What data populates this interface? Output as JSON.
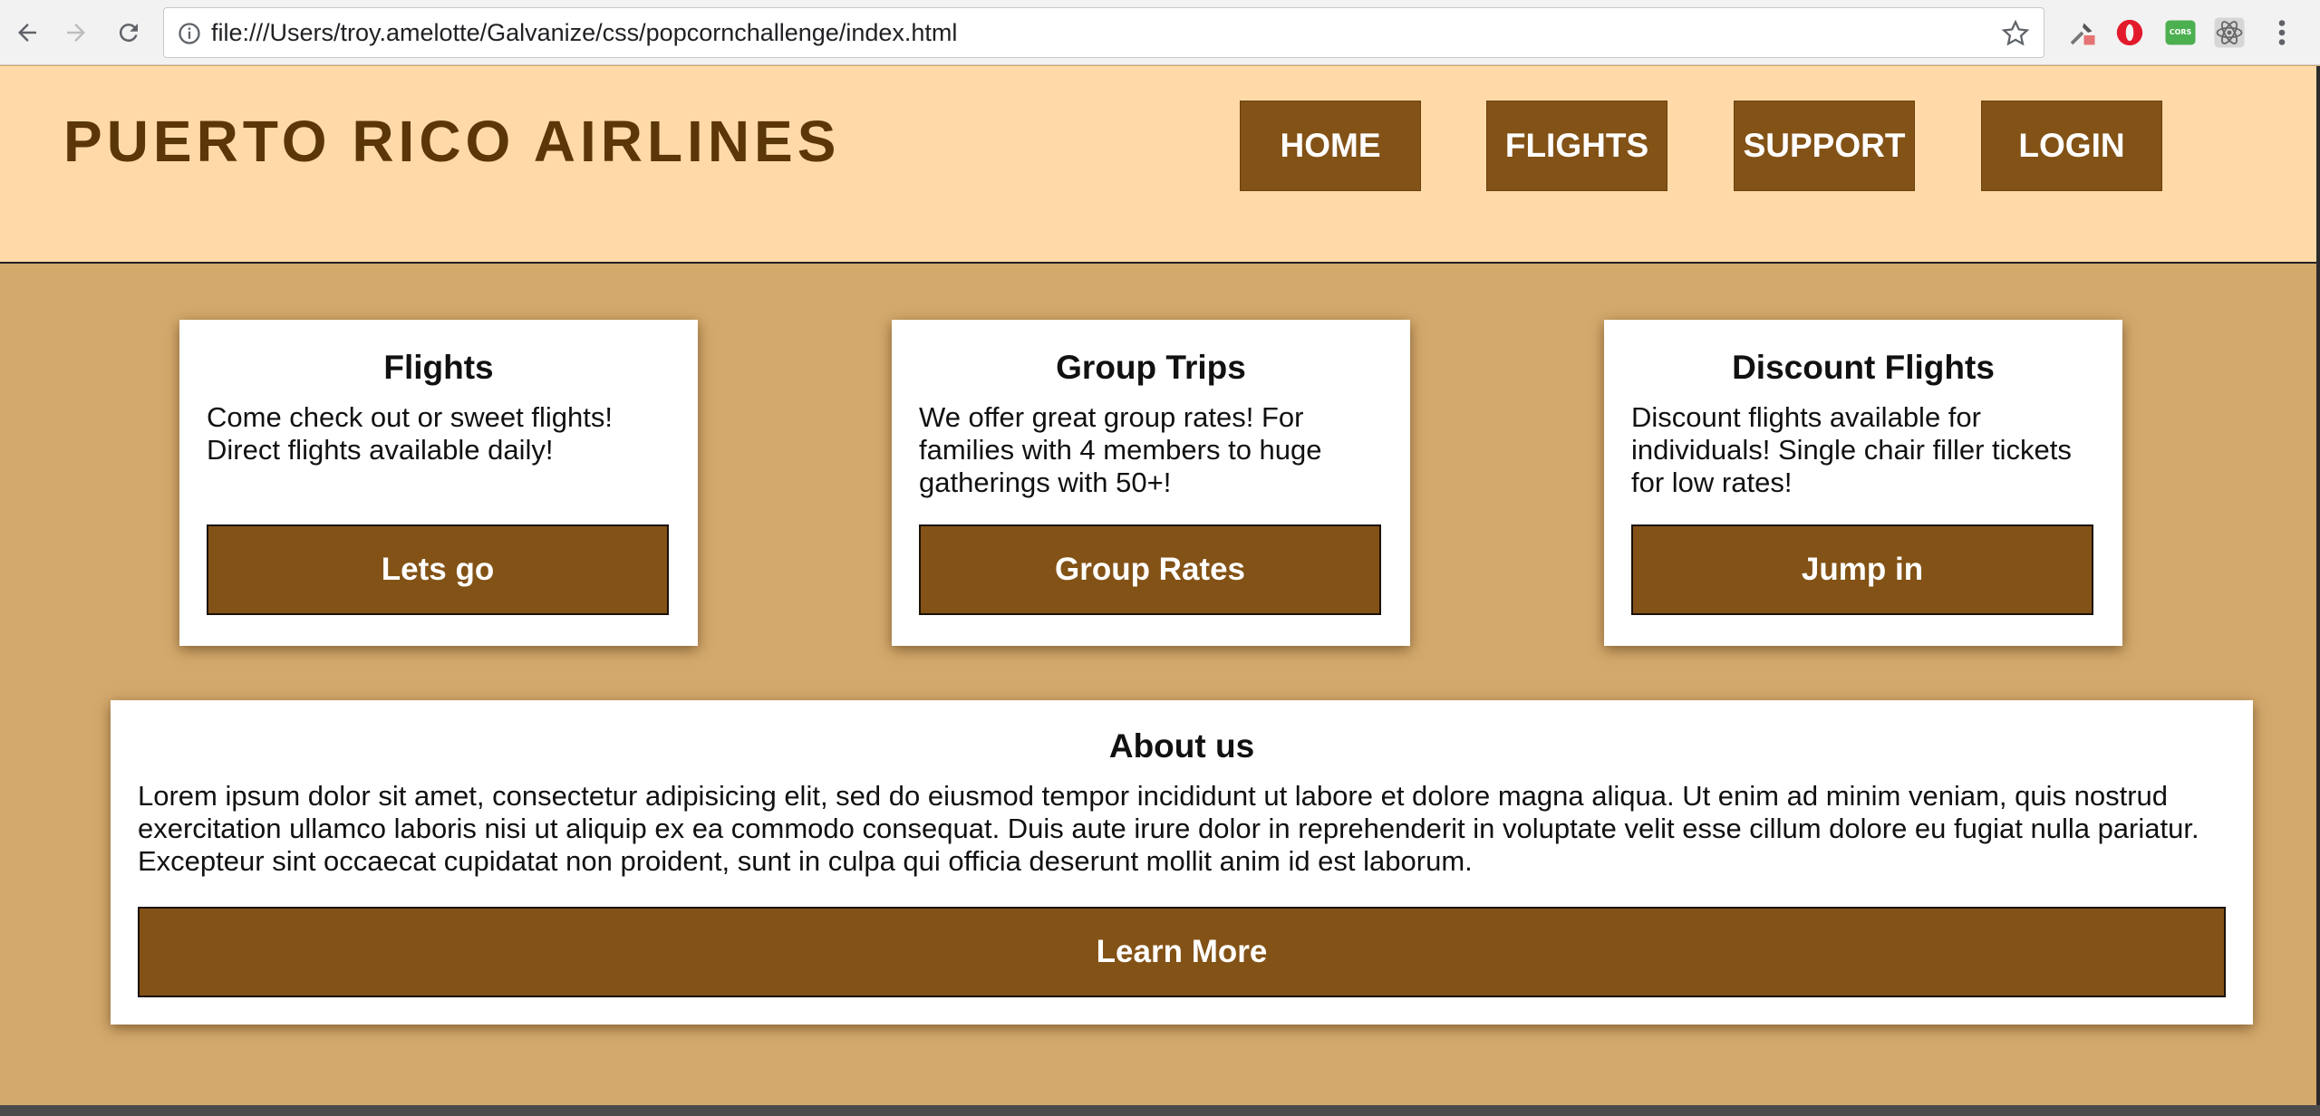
{
  "browser": {
    "url": "file:///Users/troy.amelotte/Galvanize/css/popcornchallenge/index.html",
    "icons": [
      "back-icon",
      "forward-icon",
      "reload-icon",
      "info-icon",
      "star-icon",
      "eyedropper-icon",
      "opera-icon",
      "cors-icon",
      "react-icon",
      "menu-icon"
    ],
    "cors_label": "CORS"
  },
  "header": {
    "logo": "PUERTO RICO AIRLINES",
    "nav": [
      {
        "label": "HOME"
      },
      {
        "label": "FLIGHTS"
      },
      {
        "label": "SUPPORT"
      },
      {
        "label": "LOGIN"
      }
    ]
  },
  "cards": [
    {
      "title": "Flights",
      "text": "Come check out or sweet flights! Direct flights available daily!",
      "button": "Lets go"
    },
    {
      "title": "Group Trips",
      "text": "We offer great group rates! For families with 4 members to huge gatherings with 50+!",
      "button": "Group Rates"
    },
    {
      "title": "Discount Flights",
      "text": "Discount flights available for individuals! Single chair filler tickets for low rates!",
      "button": "Jump in"
    }
  ],
  "about": {
    "title": "About us",
    "text": "Lorem ipsum dolor sit amet, consectetur adipisicing elit, sed do eiusmod tempor incididunt ut labore et dolore magna aliqua. Ut enim ad minim veniam, quis nostrud exercitation ullamco laboris nisi ut aliquip ex ea commodo consequat. Duis aute irure dolor in reprehenderit in voluptate velit esse cillum dolore eu fugiat nulla pariatur. Excepteur sint occaecat cupidatat non proident, sunt in culpa qui officia deserunt mollit anim id est laborum.",
    "button": "Learn More"
  },
  "colors": {
    "header_bg": "#ffdaa8",
    "page_bg": "#d4a96c",
    "brand_brown": "#835216",
    "logo_text": "#5b3608"
  }
}
